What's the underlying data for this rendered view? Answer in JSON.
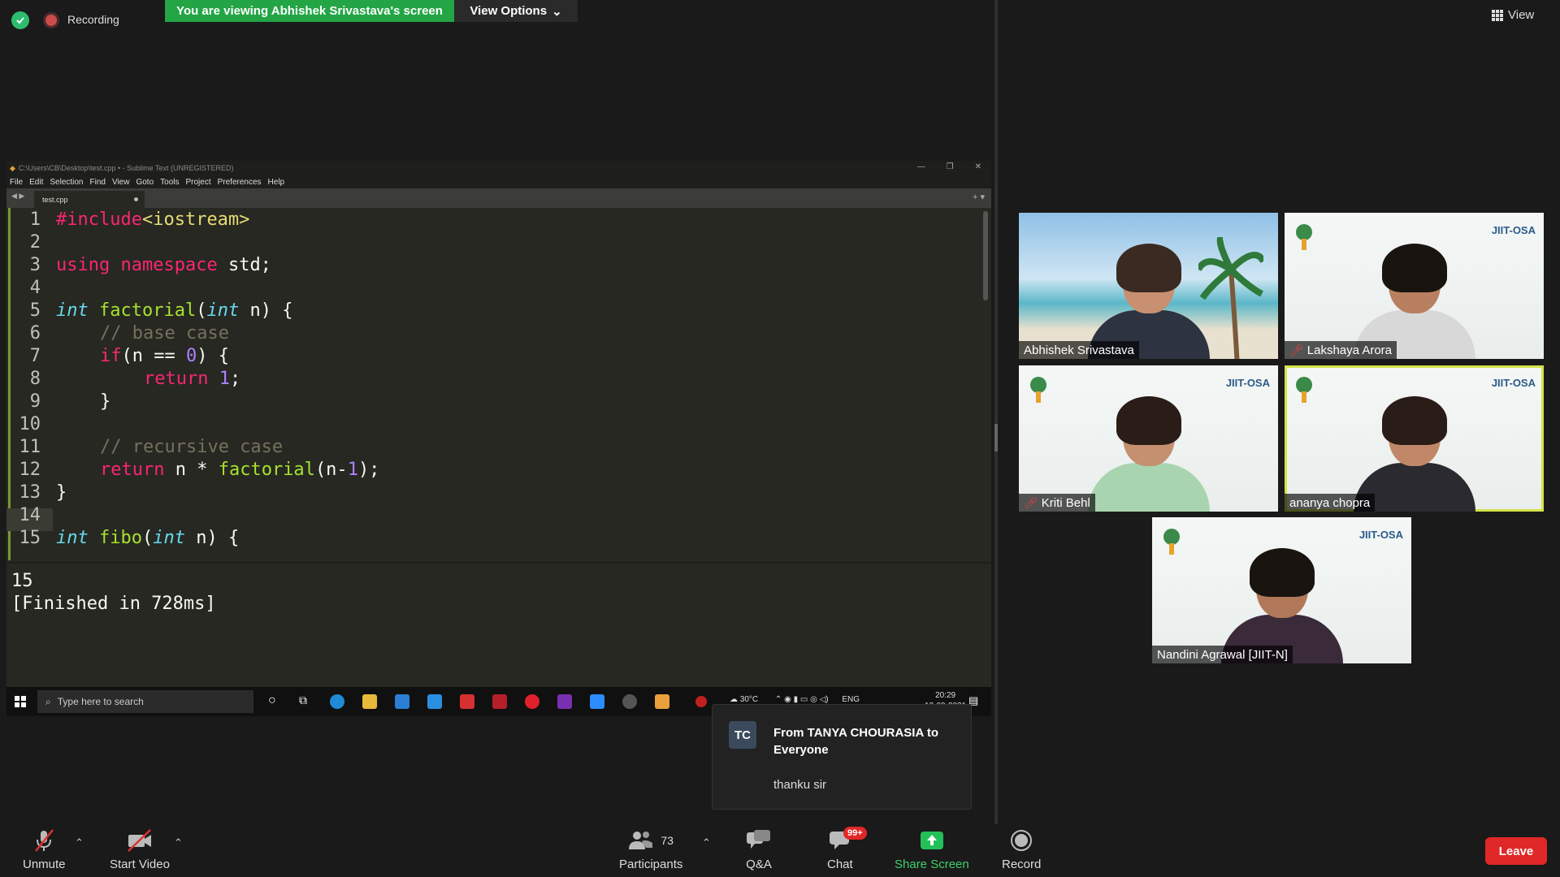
{
  "top": {
    "recording": "Recording",
    "viewing_banner": "You are viewing Abhishek Srivastava's screen",
    "view_options": "View Options",
    "view": "View"
  },
  "editor": {
    "title": "C:\\Users\\CB\\Desktop\\test.cpp • - Sublime Text (UNREGISTERED)",
    "menu": [
      "File",
      "Edit",
      "Selection",
      "Find",
      "View",
      "Goto",
      "Tools",
      "Project",
      "Preferences",
      "Help"
    ],
    "tab": "test.cpp",
    "line_numbers": [
      "1",
      "2",
      "3",
      "4",
      "5",
      "6",
      "7",
      "8",
      "9",
      "10",
      "11",
      "12",
      "13",
      "14",
      "15"
    ],
    "code": {
      "l1_a": "#include",
      "l1_b": "<iostream>",
      "l3_a": "using",
      "l3_b": "namespace",
      "l3_c": " std;",
      "l5_a": "int",
      "l5_b": "factorial",
      "l5_c": "(",
      "l5_d": "int",
      "l5_e": " n) {",
      "l6": "// base case",
      "l7_a": "if",
      "l7_b": "(n == ",
      "l7_c": "0",
      "l7_d": ") {",
      "l8_a": "return",
      "l8_b": "1",
      "l8_c": ";",
      "l9": "}",
      "l11": "// recursive case",
      "l12_a": "return",
      "l12_b": " n * ",
      "l12_c": "factorial",
      "l12_d": "(n-",
      "l12_e": "1",
      "l12_f": ");",
      "l13": "}",
      "l15_a": "int",
      "l15_b": "fibo",
      "l15_c": "(",
      "l15_d": "int",
      "l15_e": " n) {"
    },
    "output_line1": "15",
    "output_line2": "[Finished in 728ms]"
  },
  "taskbar": {
    "search_placeholder": "Type here to search",
    "weather": "30°C",
    "lang": "ENG",
    "time": "20:29",
    "date": "13-09-2021"
  },
  "participants": [
    {
      "name": "Abhishek Srivastava",
      "muted": false
    },
    {
      "name": "Lakshaya Arora",
      "muted": true
    },
    {
      "name": "Kriti Behl",
      "muted": true
    },
    {
      "name": "ananya chopra",
      "muted": false
    },
    {
      "name": "Nandini Agrawal [JIIT-N]",
      "muted": false
    }
  ],
  "tile_logo_text": "JIIT-OSA",
  "chat_popup": {
    "initials": "TC",
    "from": "From TANYA CHOURASIA to Everyone",
    "message": "thanku sir"
  },
  "controls": {
    "unmute": "Unmute",
    "start_video": "Start Video",
    "participants": "Participants",
    "participants_count": "73",
    "qa": "Q&A",
    "chat": "Chat",
    "chat_badge": "99+",
    "share_screen": "Share Screen",
    "record": "Record",
    "leave": "Leave"
  },
  "colors": {
    "viewing_green": "#23a545",
    "leave_red": "#e02828",
    "share_green": "#23c05a",
    "speaking_outline": "#d4e34a"
  }
}
